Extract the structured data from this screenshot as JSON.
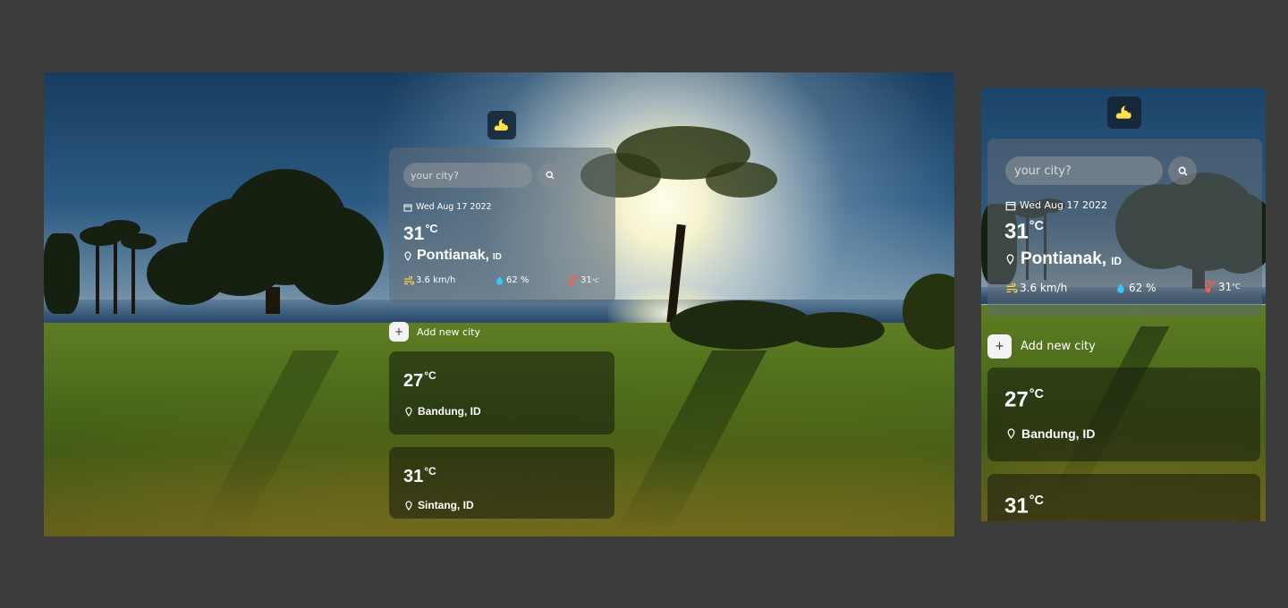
{
  "brand": {
    "icon": "moon-cloud-icon",
    "accent": "#ffe14a"
  },
  "search": {
    "placeholder": "your city?",
    "button_icon": "search-icon"
  },
  "current": {
    "date": "Wed Aug 17 2022",
    "temp": "31",
    "unit": "°C",
    "city": "Pontianak,",
    "country": "ID",
    "wind": "3.6 km/h",
    "humidity": "62 %",
    "feels_like": "31",
    "feels_unit": "°C"
  },
  "add_city": {
    "label": "Add new city",
    "icon": "+"
  },
  "saved_cities": [
    {
      "temp": "27",
      "unit": "°C",
      "name": "Bandung, ID"
    },
    {
      "temp": "31",
      "unit": "°C",
      "name": "Sintang, ID"
    }
  ],
  "colors": {
    "page_bg": "#3c3c3c",
    "wind_icon": "#ffd23a",
    "humidity_icon": "#36c6ff",
    "thermo_icon": "#ff5a4f"
  }
}
